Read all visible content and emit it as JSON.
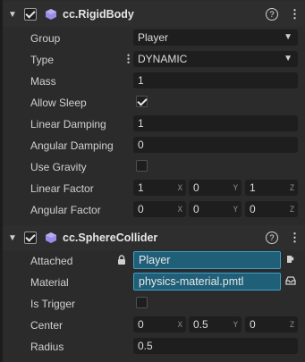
{
  "rigidbody": {
    "title": "cc.RigidBody",
    "group_label": "Group",
    "group_value": "Player",
    "type_label": "Type",
    "type_value": "DYNAMIC",
    "mass_label": "Mass",
    "mass_value": "1",
    "allow_sleep_label": "Allow Sleep",
    "allow_sleep": true,
    "linear_damping_label": "Linear Damping",
    "linear_damping_value": "1",
    "angular_damping_label": "Angular Damping",
    "angular_damping_value": "0",
    "use_gravity_label": "Use Gravity",
    "use_gravity": false,
    "linear_factor_label": "Linear Factor",
    "linear_factor": {
      "x": "1",
      "y": "0",
      "z": "1"
    },
    "angular_factor_label": "Angular Factor",
    "angular_factor": {
      "x": "0",
      "y": "0",
      "z": "0"
    }
  },
  "spherecollider": {
    "title": "cc.SphereCollider",
    "attached_label": "Attached",
    "attached_value": "Player",
    "material_label": "Material",
    "material_value": "physics-material.pmtl",
    "is_trigger_label": "Is Trigger",
    "is_trigger": false,
    "center_label": "Center",
    "center": {
      "x": "0",
      "y": "0.5",
      "z": "0"
    },
    "radius_label": "Radius",
    "radius_value": "0.5"
  },
  "axis_labels": {
    "x": "X",
    "y": "Y",
    "z": "Z"
  },
  "header_icons": {
    "help": "?",
    "menu": "⋮"
  },
  "colors": {
    "background": "#2b2b2b",
    "field": "#1e1e1e",
    "asset_fill": "#1f5f78",
    "asset_border": "#3ea0c8",
    "component_icon": "#9b8ce6"
  }
}
